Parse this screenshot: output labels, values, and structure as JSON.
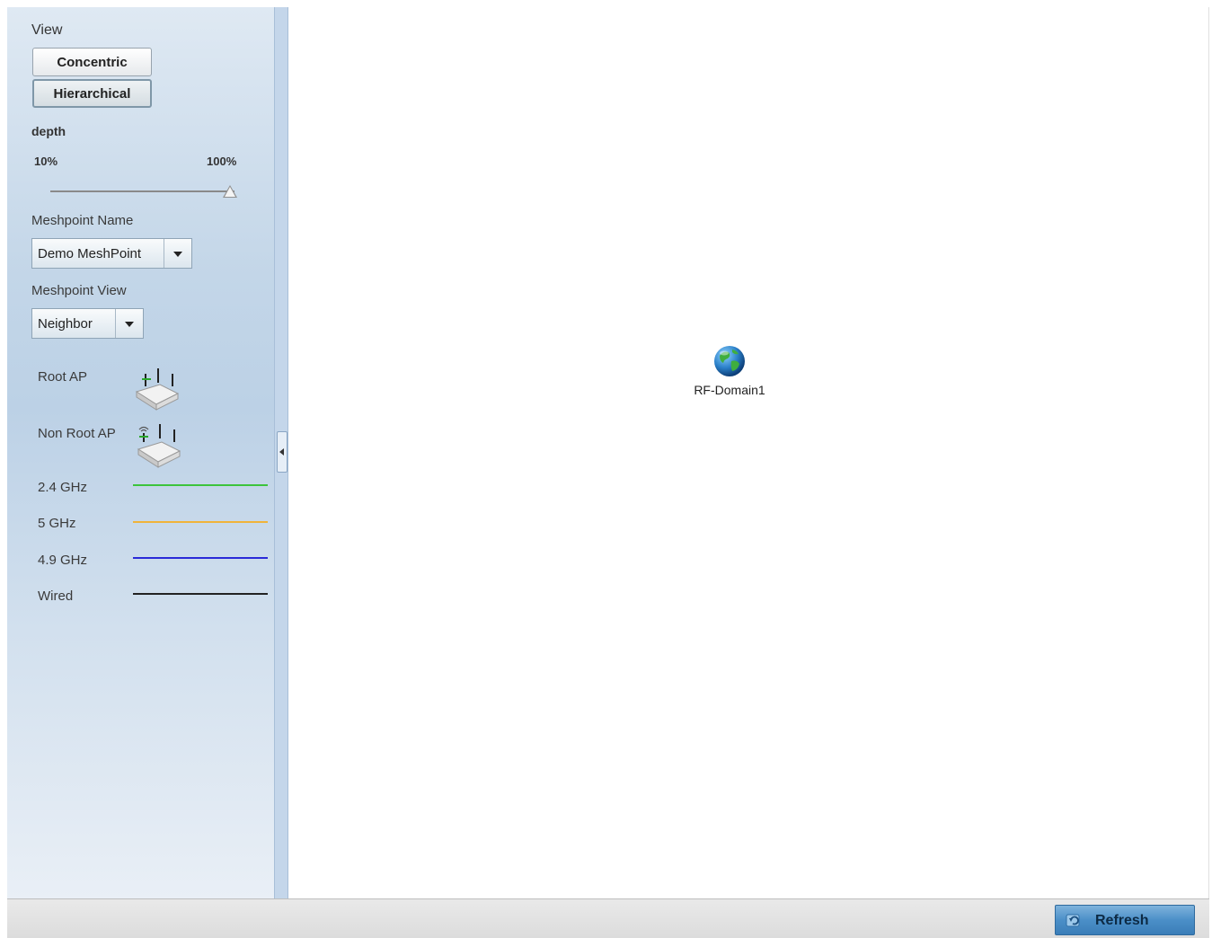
{
  "sidebar": {
    "view_label": "View",
    "view_buttons": {
      "concentric": "Concentric",
      "hierarchical": "Hierarchical",
      "selected": "hierarchical"
    },
    "depth": {
      "label": "depth",
      "min_label": "10%",
      "max_label": "100%",
      "value_percent": 100
    },
    "meshpoint_name": {
      "label": "Meshpoint Name",
      "value": "Demo MeshPoint"
    },
    "meshpoint_view": {
      "label": "Meshpoint View",
      "value": "Neighbor"
    },
    "legend": {
      "root_ap": "Root AP",
      "non_root_ap": "Non Root AP",
      "links": [
        {
          "label": "2.4 GHz",
          "color": "#3cc43c"
        },
        {
          "label": "5 GHz",
          "color": "#f0b33a"
        },
        {
          "label": "4.9 GHz",
          "color": "#2a2ad8"
        },
        {
          "label": "Wired",
          "color": "#222222"
        }
      ]
    }
  },
  "topology": {
    "nodes": [
      {
        "label": "RF-Domain1",
        "icon": "globe-icon"
      }
    ]
  },
  "footer": {
    "refresh_label": "Refresh"
  }
}
